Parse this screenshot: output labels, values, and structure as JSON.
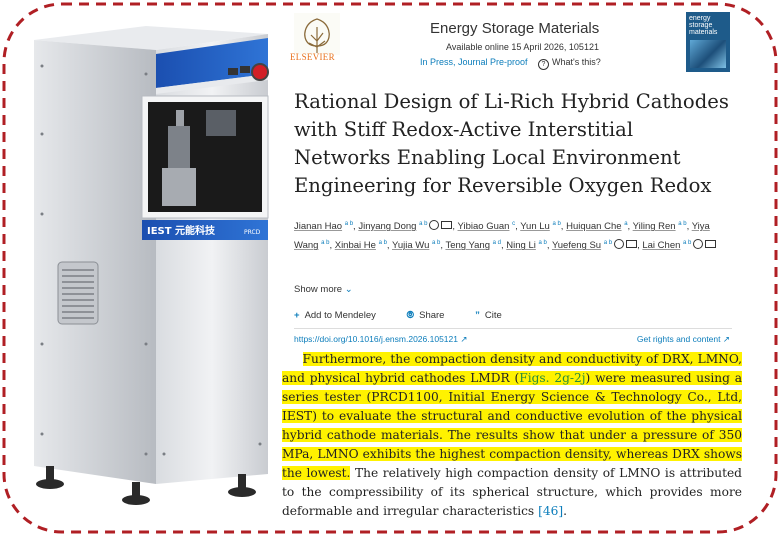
{
  "journal": {
    "publisher": "ELSEVIER",
    "name": "Energy Storage Materials",
    "available": "Available online 15 April 2026, 105121",
    "in_press": "In Press, Journal Pre-proof",
    "whats_this": "What's this?",
    "cover_title": "energy storage materials"
  },
  "article": {
    "title": "Rational Design of Li-Rich Hybrid Cathodes with Stiff Redox-Active Interstitial Networks Enabling Local Environment Engineering for Reversible Oxygen Redox",
    "authors": [
      {
        "name": "Jianan Hao",
        "aff": "a b"
      },
      {
        "name": "Jinyang Dong",
        "aff": "a b",
        "corr": true
      },
      {
        "name": "Yibiao Guan",
        "aff": "c"
      },
      {
        "name": "Yun Lu",
        "aff": "a b"
      },
      {
        "name": "Huiquan Che",
        "aff": "a"
      },
      {
        "name": "Yiling Ren",
        "aff": "a b"
      },
      {
        "name": "Yiya Wang",
        "aff": "a b"
      },
      {
        "name": "Xinbai He",
        "aff": "a b"
      },
      {
        "name": "Yujia Wu",
        "aff": "a b"
      },
      {
        "name": "Teng Yang",
        "aff": "a d"
      },
      {
        "name": "Ning Li",
        "aff": "a b"
      },
      {
        "name": "Yuefeng Su",
        "aff": "a b",
        "corr": true
      },
      {
        "name": "Lai Chen",
        "aff": "a b",
        "corr": true
      }
    ],
    "show_more": "Show more",
    "actions": {
      "mendeley": "Add to Mendeley",
      "share": "Share",
      "cite": "Cite"
    },
    "doi": "https://doi.org/10.1016/j.ensm.2026.105121",
    "rights": "Get rights and content",
    "body": {
      "p1": "Furthermore, the compaction density and conductivity of DRX, LMNO, and physical hybrid cathodes LMDR (",
      "figs": "Figs. 2g-2j",
      "p2": ") were measured using a series tester (PRCD1100, Initial Energy Science & Technology Co., Ltd, IEST) to evaluate the structural and conductive evolution of the physical hybrid cathode materials. The results show that under a pressure of 350 MPa, LMNO exhibits the highest compaction density, whereas DRX shows the lowest.",
      "p3": " The relatively high compaction density of LMNO is attributed to the compressibility of its spherical structure, which provides more deformable and irregular characteristics ",
      "ref": "[46]",
      "end": "."
    }
  },
  "machine": {
    "brand": "IEST 元能科技",
    "model": "PRCD"
  },
  "colors": {
    "frame": "#b01f24",
    "highlight": "#fff200",
    "link": "#0c7dbb",
    "machine_blue": "#1f5fbf"
  }
}
